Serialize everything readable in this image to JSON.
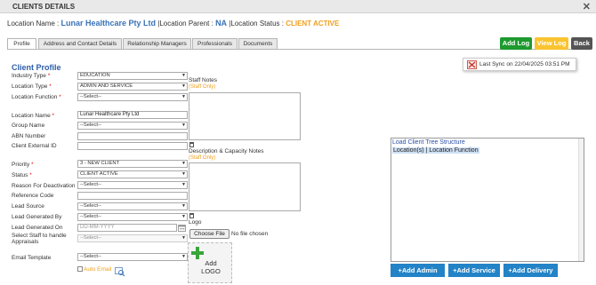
{
  "window": {
    "title": "CLIENTS DETAILS",
    "close": "✕"
  },
  "header": {
    "location_name_label": "Location Name :",
    "location_name": "Lunar Healthcare Pty Ltd",
    "location_parent_label": "|Location Parent :",
    "location_parent": "NA",
    "location_status_label": "|Location Status :",
    "location_status": "CLIENT ACTIVE"
  },
  "tabs": [
    "Profile",
    "Address and Contact Details",
    "Relationship Managers",
    "Professionals",
    "Documents"
  ],
  "actions": {
    "add_log": "Add Log",
    "view_log": "View Log",
    "back": "Back"
  },
  "sync": {
    "text": "Last Sync on 22/04/2025 03:51 PM",
    "icon": "sync-error-icon"
  },
  "profile": {
    "title": "Client Profile",
    "industry_type": {
      "label": "Industry Type",
      "value": "EDUCATION"
    },
    "location_type": {
      "label": "Location Type",
      "value": "ADMIN AND SERVICE"
    },
    "location_function": {
      "label": "Location Function",
      "value": "--Select--"
    },
    "location_name": {
      "label": "Location Name",
      "value": "Lunar Healthcare Pty Ltd"
    },
    "group_name": {
      "label": "Group Name",
      "value": "--Select--"
    },
    "abn_number": {
      "label": "ABN Number",
      "value": ""
    },
    "client_external_id": {
      "label": "Client External ID",
      "value": ""
    },
    "priority": {
      "label": "Priority",
      "value": "3 - NEW CLIENT"
    },
    "status": {
      "label": "Status",
      "value": "CLIENT ACTIVE"
    },
    "reason_deactivation": {
      "label": "Reason For Deactivation",
      "value": "--Select--"
    },
    "reference_code": {
      "label": "Reference Code",
      "value": ""
    },
    "lead_source": {
      "label": "Lead Source",
      "value": "--Select--"
    },
    "lead_generated_by": {
      "label": "Lead Generated By",
      "value": "--Select--"
    },
    "lead_generated_on": {
      "label": "Lead Generated On",
      "placeholder": "DD-MM-YYYY"
    },
    "staff_appraisals": {
      "label_1": "Select Staff to handle",
      "label_2": "Appraisals",
      "value": "--Select--"
    },
    "email_template": {
      "label": "Email Template",
      "value": "--Select--"
    },
    "auto_email": {
      "label": "Auto Email"
    }
  },
  "notes": {
    "staff_notes": "Staff Notes",
    "staff_only": "(Staff Only)",
    "desc_notes": "Description & Capacity Notes",
    "staff_only_2": "(Staff Only)",
    "logo_label": "Logo",
    "choose_file": "Choose File",
    "no_file": "No file chosen",
    "add_logo_1": "Add",
    "add_logo_2": "LOGO"
  },
  "tree": {
    "load_link": "Load Client Tree Structure",
    "row": "Location(s) | Location Function"
  },
  "bottom_buttons": {
    "add_admin": "+Add Admin",
    "add_service": "+Add Service",
    "add_delivery": "+Add Delivery"
  },
  "colors": {
    "accent_blue": "#3a73b8",
    "status_orange": "#f0a020",
    "add_log_green": "#1e9a2e",
    "view_log_yellow": "#f9c430",
    "back_dark": "#545454",
    "button_blue": "#2283c7"
  }
}
